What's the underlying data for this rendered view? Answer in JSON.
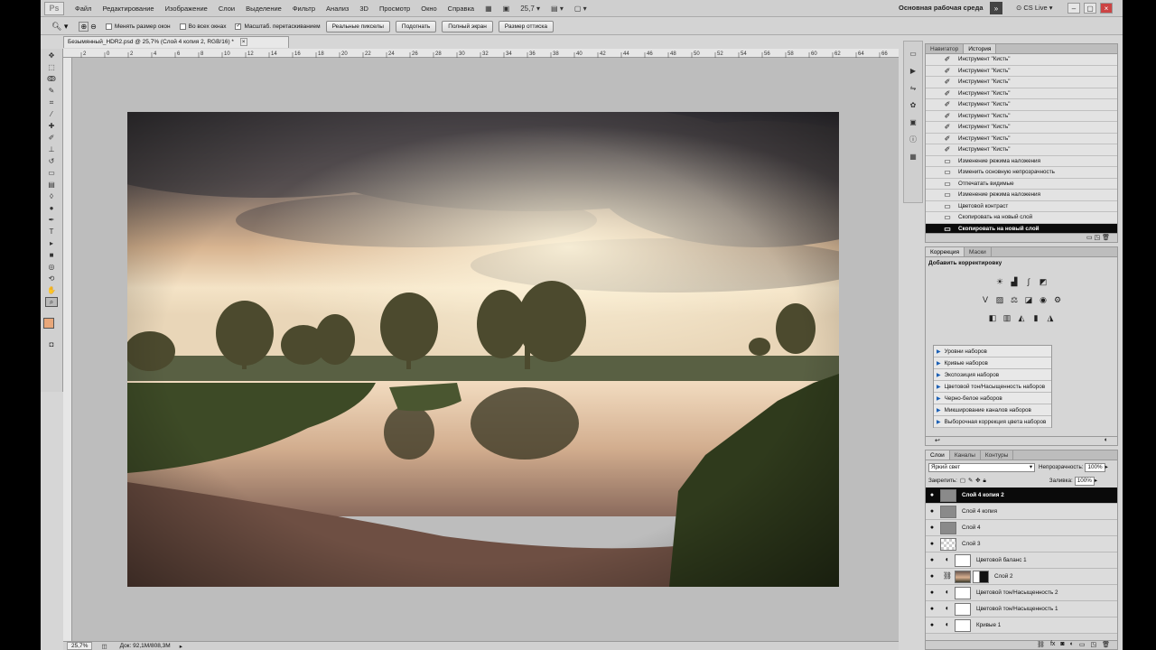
{
  "menubar": {
    "logo": "Ps",
    "items": [
      "Файл",
      "Редактирование",
      "Изображение",
      "Слои",
      "Выделение",
      "Фильтр",
      "Анализ",
      "3D",
      "Просмотр",
      "Окно",
      "Справка"
    ],
    "zoom_value": "25,7",
    "workspace": "Основная рабочая среда",
    "workspace_btn": "»",
    "cs_live": "CS Live"
  },
  "options": {
    "chk_resize": "Менять размер окон",
    "chk_all": "Во всех окнах",
    "chk_scrubby": "Масштаб. перетаскиванием",
    "btn_actual": "Реальные пикселы",
    "btn_fit": "Подогнать",
    "btn_full": "Полный экран",
    "btn_print": "Размер оттиска"
  },
  "document": {
    "tab_title": "Безымянный_HDR2.psd @ 25,7% (Слой 4 копия 2, RGB/16) *",
    "close": "×",
    "zoom_status": "25,7%",
    "doc_status": "Док: 92,1M/808,3M"
  },
  "ruler_labels": [
    "2",
    "0",
    "2",
    "4",
    "6",
    "8",
    "10",
    "12",
    "14",
    "16",
    "18",
    "20",
    "22",
    "24",
    "26",
    "28",
    "30",
    "32",
    "34",
    "36",
    "38",
    "40",
    "42",
    "44",
    "46",
    "48",
    "50",
    "52",
    "54",
    "56",
    "58",
    "60",
    "62",
    "64",
    "66",
    "68"
  ],
  "history": {
    "tabs": [
      "Навигатор",
      "История"
    ],
    "items": [
      "Инструмент \"Кисть\"",
      "Инструмент \"Кисть\"",
      "Инструмент \"Кисть\"",
      "Инструмент \"Кисть\"",
      "Инструмент \"Кисть\"",
      "Инструмент \"Кисть\"",
      "Инструмент \"Кисть\"",
      "Инструмент \"Кисть\"",
      "Инструмент \"Кисть\"",
      "Изменение режима наложения",
      "Изменить основную непрозрачность",
      "Отпечатать видимые",
      "Изменение режима наложения",
      "Цветовой контраст",
      "Скопировать на новый слой",
      "Скопировать на новый слой"
    ]
  },
  "correction": {
    "tabs": [
      "Коррекция",
      "Маски"
    ],
    "title": "Добавить корректировку",
    "presets": [
      "Уровни наборов",
      "Кривые наборов",
      "Экспозиция наборов",
      "Цветовой тон/Насыщенность наборов",
      "Черно-белое наборов",
      "Микширование каналов наборов",
      "Выборочная коррекция цвета наборов"
    ]
  },
  "layers": {
    "tabs": [
      "Слои",
      "Каналы",
      "Контуры"
    ],
    "blend_mode": "Яркий свет",
    "opacity_label": "Непрозрачность:",
    "opacity_value": "100%",
    "lock_label": "Закрепить:",
    "fill_label": "Заливка:",
    "fill_value": "100%",
    "items": [
      {
        "name": "Слой 4 копия 2"
      },
      {
        "name": "Слой 4 копия"
      },
      {
        "name": "Слой 4"
      },
      {
        "name": "Слой 3"
      },
      {
        "name": "Цветовой баланс 1"
      },
      {
        "name": "Слой 2"
      },
      {
        "name": "Цветовой тон/Насыщенность 2"
      },
      {
        "name": "Цветовой тон/Насыщенность 1"
      },
      {
        "name": "Кривые 1"
      }
    ]
  }
}
